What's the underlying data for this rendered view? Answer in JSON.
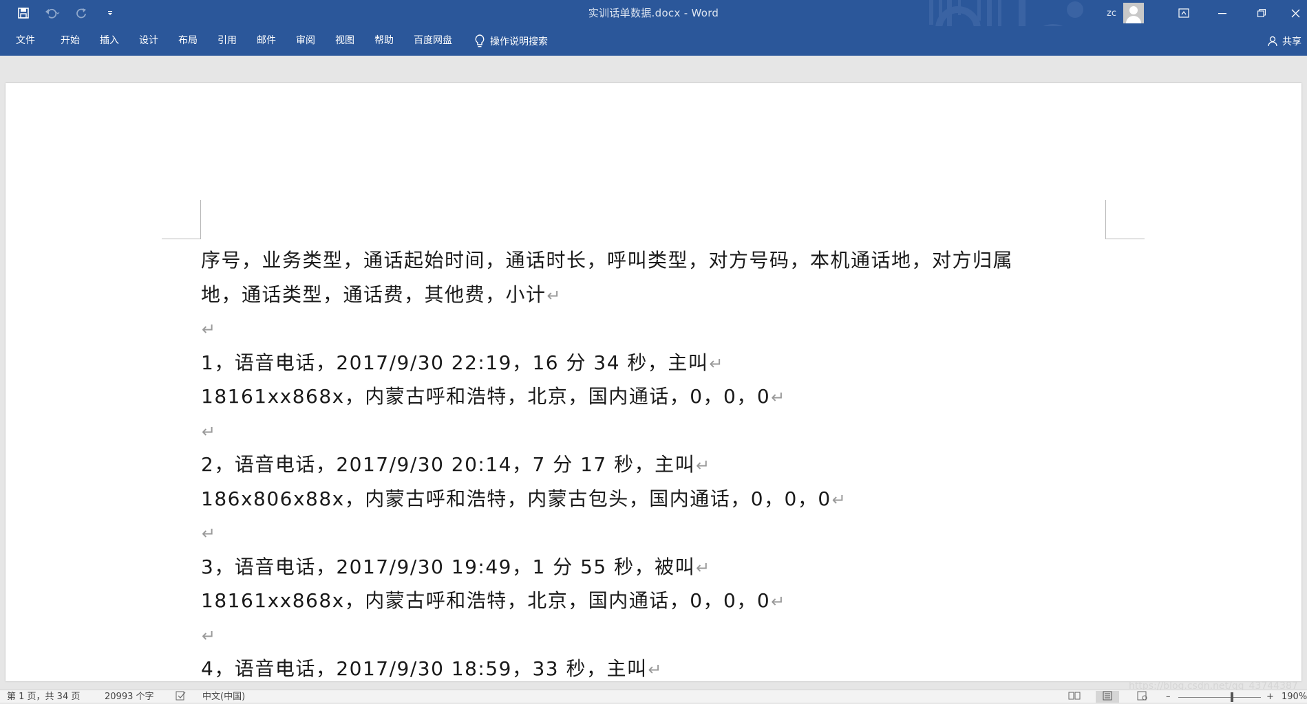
{
  "window": {
    "title": "实训话单数据.docx  -  Word",
    "user": "zc"
  },
  "quick_access": {
    "save": "save-icon",
    "undo": "undo-icon",
    "redo": "redo-icon",
    "customize": "chevron-down-icon"
  },
  "ribbon": {
    "tabs": [
      "文件",
      "开始",
      "插入",
      "设计",
      "布局",
      "引用",
      "邮件",
      "审阅",
      "视图",
      "帮助",
      "百度网盘"
    ],
    "tell_me": "操作说明搜索",
    "share": "共享"
  },
  "document": {
    "lines": [
      "序号，业务类型，通话起始时间，通话时长，呼叫类型，对方号码，本机通话地，对方归属",
      "地，通话类型，通话费，其他费，小计",
      "",
      "1，语音电话，2017/9/30 22:19，16 分 34 秒，主叫",
      "18161xx868x，内蒙古呼和浩特，北京，国内通话，0，0，0",
      "",
      "2，语音电话，2017/9/30 20:14，7 分 17 秒，主叫",
      "186x806x88x，内蒙古呼和浩特，内蒙古包头，国内通话，0，0，0",
      "",
      "3，语音电话，2017/9/30 19:49，1 分 55 秒，被叫",
      "18161xx868x，内蒙古呼和浩特，北京，国内通话，0，0，0",
      "",
      "4，语音电话，2017/9/30 18:59，33 秒，主叫"
    ],
    "paragraph_mark": "↵"
  },
  "statusbar": {
    "page": "第 1 页，共 34 页",
    "words": "20993 个字",
    "language": "中文(中国)",
    "zoom": "190%",
    "watermark": "https://blog.csdn.net/qq_43744387"
  },
  "colors": {
    "ribbon_blue": "#2b579a",
    "page_white": "#ffffff",
    "canvas_gray": "#e6e6e6"
  }
}
